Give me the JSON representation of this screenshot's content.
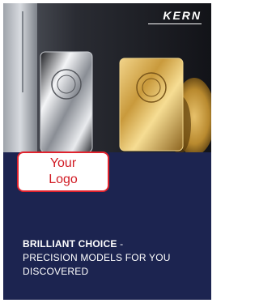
{
  "brand": {
    "name": "KERN"
  },
  "logo_placeholder": {
    "line1": "Your",
    "line2": "Logo"
  },
  "headline": {
    "bold": "BRILLIANT CHOICE",
    "dash": " -",
    "line2": "PRECISION MODELS FOR YOU",
    "line3": "DISCOVERED"
  },
  "colors": {
    "background": "#1c2450",
    "logo_border": "#e0222d",
    "logo_text": "#d11a23"
  }
}
